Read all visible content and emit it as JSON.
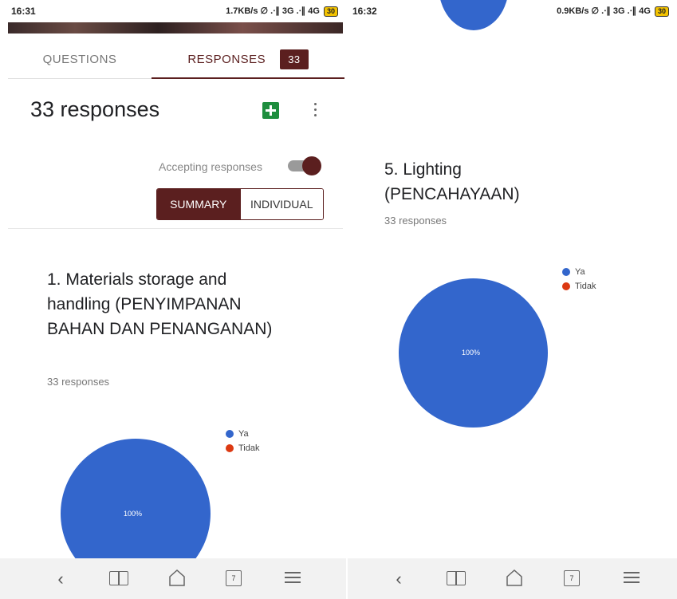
{
  "left": {
    "status": {
      "time": "16:31",
      "indicators": "1.7KB/s ∅ .∙∥ 3G .∙∥ 4G",
      "battery": "30"
    },
    "tabs": {
      "questions": "QUESTIONS",
      "responses": "RESPONSES",
      "badge": "33"
    },
    "header": {
      "title": "33 responses",
      "sheets_icon": "sheets-icon",
      "more_icon": "more-vert-icon"
    },
    "accepting_label": "Accepting responses",
    "view_toggle": {
      "summary": "SUMMARY",
      "individual": "INDIVIDUAL"
    },
    "question": {
      "title": "1. Materials storage and handling (PENYIMPANAN BAHAN DAN PENANGANAN)",
      "count": "33 responses",
      "chart_data": {
        "type": "pie",
        "categories": [
          "Ya",
          "Tidak"
        ],
        "values": [
          100,
          0
        ],
        "data_labels": [
          "100%"
        ]
      }
    }
  },
  "right": {
    "status": {
      "time": "16:32",
      "indicators": "0.9KB/s ∅ .∙∥ 3G .∙∥ 4G",
      "battery": "30"
    },
    "question": {
      "title": "5. Lighting (PENCAHAYAAN)",
      "count": "33 responses",
      "chart_data": {
        "type": "pie",
        "categories": [
          "Ya",
          "Tidak"
        ],
        "values": [
          100,
          0
        ],
        "data_labels": [
          "100%"
        ]
      }
    }
  },
  "legend": [
    {
      "label": "Ya",
      "color": "#3366cc"
    },
    {
      "label": "Tidak",
      "color": "#dc3912"
    }
  ],
  "navbar": {
    "back": "back-icon",
    "bookmarks": "book-icon",
    "home": "home-icon",
    "tabs_count": "7",
    "menu": "menu-icon"
  },
  "colors": {
    "accent": "#5b1f1f",
    "pie": "#3366cc",
    "sheets": "#1e8e3e"
  }
}
